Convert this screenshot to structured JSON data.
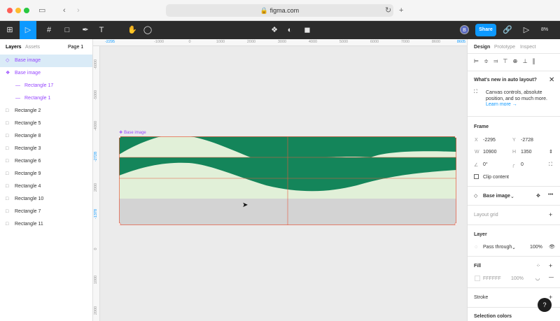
{
  "browser": {
    "url": "figma.com"
  },
  "toolbar": {
    "avatar": "B",
    "share": "Share",
    "zoom": "8%"
  },
  "left_panel": {
    "tabs": [
      "Layers",
      "Assets"
    ],
    "page": "Page 1",
    "layers": [
      "Base image",
      "Base image",
      "Rectangle 17",
      "Rectangle 1",
      "Rectangle 2",
      "Rectangle 5",
      "Rectangle 8",
      "Rectangle 3",
      "Rectangle 6",
      "Rectangle 9",
      "Rectangle 4",
      "Rectangle 10",
      "Rectangle 7",
      "Rectangle 11"
    ]
  },
  "canvas": {
    "frame_label": "Base image",
    "hruler": [
      "-2295",
      "-1000",
      "0",
      "1000",
      "2000",
      "3000",
      "4000",
      "5000",
      "6000",
      "7000",
      "8600",
      "8605"
    ],
    "vruler": [
      "-6000",
      "-5000",
      "-4000",
      "-2728",
      "2000",
      "-1378",
      "0",
      "1000",
      "2000"
    ],
    "colors": {
      "dark": "#14855a",
      "light": "#e1f0d8",
      "band": "#d3d3d3",
      "selection": "#e8593f"
    }
  },
  "right_panel": {
    "tabs": [
      "Design",
      "Prototype",
      "Inspect"
    ],
    "whats_new": {
      "title": "What's new in auto layout?",
      "body": "Canvas controls, absolute position, and so much more.",
      "link": "Learn more →"
    },
    "frame": {
      "title": "Frame",
      "x_label": "X",
      "x": "-2295",
      "y_label": "Y",
      "y": "-2728",
      "w_label": "W",
      "w": "10900",
      "h_label": "H",
      "h": "1350",
      "rotation": "0°",
      "radius": "0",
      "clip": "Clip content"
    },
    "component": "Base image",
    "layout_grid": "Layout grid",
    "layer": {
      "title": "Layer",
      "mode": "Pass through",
      "opacity": "100%"
    },
    "fill": {
      "title": "Fill",
      "hex": "FFFFFF",
      "opacity": "100%"
    },
    "stroke": "Stroke",
    "selection_colors": "Selection colors",
    "help": "?"
  }
}
